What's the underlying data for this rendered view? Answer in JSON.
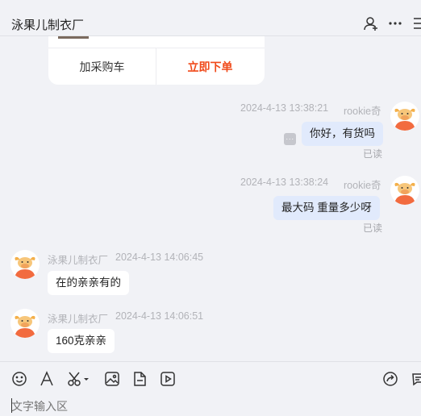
{
  "header": {
    "title": "泳果儿制衣厂",
    "icons": [
      "add-contact-icon",
      "more-icon",
      "menu-icon"
    ]
  },
  "product_card": {
    "cart_label": "加采购车",
    "buy_label": "立即下单"
  },
  "messages": [
    {
      "sender": "rookie奇",
      "time": "2024-4-13 13:38:21",
      "text": "你好，有货吗",
      "side": "mine",
      "status": "已读"
    },
    {
      "sender": "rookie奇",
      "time": "2024-4-13 13:38:24",
      "text": "最大码  重量多少呀",
      "side": "mine",
      "status": "已读"
    },
    {
      "sender": "泳果儿制衣厂",
      "time": "2024-4-13 14:06:45",
      "text": "在的亲亲有的",
      "side": "theirs"
    },
    {
      "sender": "泳果儿制衣厂",
      "time": "2024-4-13 14:06:51",
      "text": "160克亲亲",
      "side": "theirs"
    }
  ],
  "toolbar": {
    "tools": [
      "emoji-icon",
      "font-icon",
      "scissors-icon",
      "image-icon",
      "file-icon",
      "video-icon",
      "share-icon",
      "quick-reply-icon"
    ]
  },
  "input": {
    "placeholder": "文字输入区",
    "value": ""
  },
  "colors": {
    "background": "#f1f2f6",
    "my_bubble": "#e1eafc",
    "buy_accent": "#f04a1a"
  }
}
